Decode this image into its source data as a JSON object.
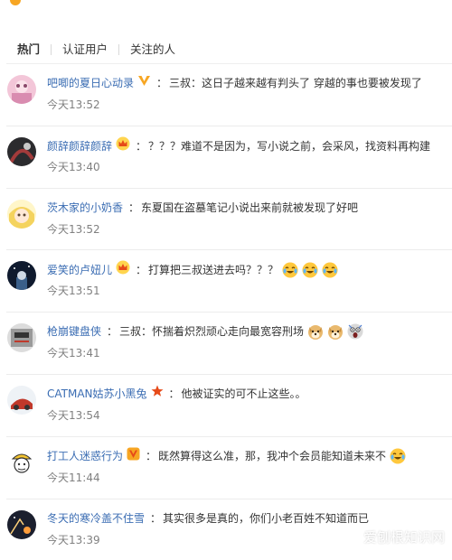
{
  "tabs": [
    {
      "label": "热门"
    },
    {
      "label": "认证用户"
    },
    {
      "label": "关注的人"
    }
  ],
  "comments": [
    {
      "user": "吧唧的夏日心动录",
      "badge": "v-badge",
      "text": "三叔：这日子越来越有判头了 穿越的事也要被发现了",
      "time": "今天13:52",
      "emojis": []
    },
    {
      "user": "颜辞颜辞颜辞",
      "badge": "crown-badge",
      "text": "？？？难道不是因为，写小说之前，会采风，找资料再构建",
      "time": "今天13:40",
      "emojis": []
    },
    {
      "user": "茨木家的小奶香",
      "badge": "",
      "text": "东夏国在盗墓笔记小说出来前就被发现了好吧",
      "time": "今天13:52",
      "emojis": []
    },
    {
      "user": "爱笑的卢妞儿",
      "badge": "crown-badge",
      "text": "打算把三叔送进去吗？？？",
      "time": "今天13:51",
      "emojis": [
        "laugh-cry-emoji",
        "laugh-cry-emoji",
        "laugh-cry-emoji"
      ]
    },
    {
      "user": "枪崩键盘侠",
      "badge": "",
      "text": "三叔：怀揣着炽烈顽心走向最宽容刑场",
      "time": "今天13:41",
      "emojis": [
        "doge-emoji",
        "doge-emoji",
        "shocked-emoji"
      ]
    },
    {
      "user": "CATMAN姑苏小黑兔",
      "badge": "star-badge",
      "text": "他被证实的可不止这些。。",
      "time": "今天13:54",
      "emojis": []
    },
    {
      "user": "打工人迷惑行为",
      "badge": "v-badge-red",
      "text": "既然算得这么准，那，我冲个会员能知道未来不",
      "time": "今天11:44",
      "emojis": [
        "laugh-cry-emoji"
      ]
    },
    {
      "user": "冬天的寒冷盖不住雪",
      "badge": "",
      "text": "其实很多是真的，你们小老百姓不知道而已",
      "time": "今天13:39",
      "emojis": []
    }
  ],
  "watermark": {
    "text": "爱刨根知识网"
  },
  "colors": {
    "link": "#3b6db3",
    "text": "#333333",
    "time": "#808080",
    "gold": "#f7a623",
    "red": "#e64a19"
  }
}
